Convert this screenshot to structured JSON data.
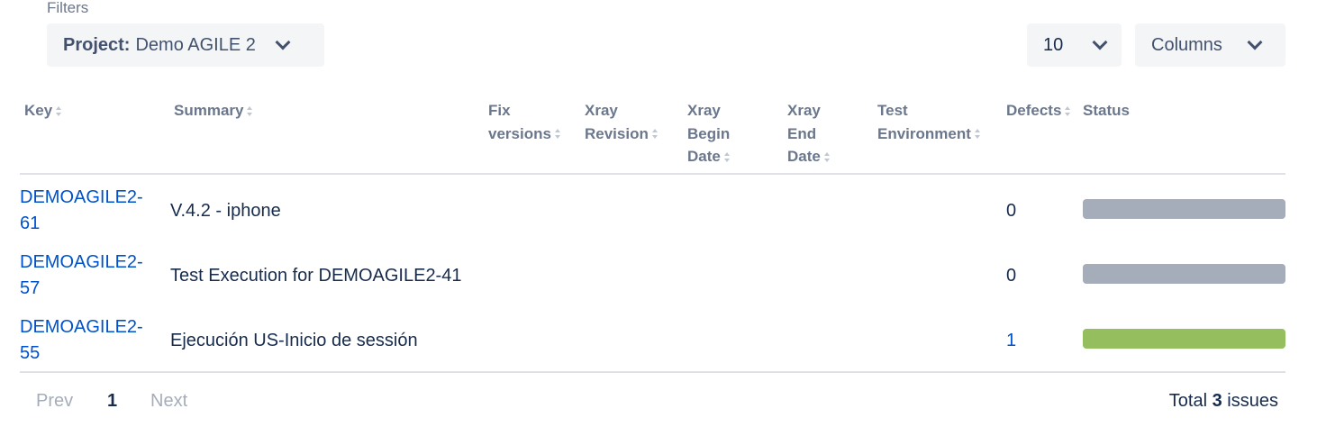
{
  "filters": {
    "label": "Filters",
    "project_key": "Project:",
    "project_value": "Demo AGILE 2"
  },
  "page_size": {
    "value": "10"
  },
  "columns_button": {
    "label": "Columns"
  },
  "headers": {
    "key": "Key",
    "summary": "Summary",
    "fix_versions": [
      "Fix",
      "versions"
    ],
    "xray_revision": [
      "Xray",
      "Revision"
    ],
    "xray_begin_date": [
      "Xray",
      "Begin",
      "Date"
    ],
    "xray_end_date": [
      "Xray",
      "End",
      "Date"
    ],
    "test_environment": [
      "Test",
      "Environment"
    ],
    "defects": "Defects",
    "status": "Status"
  },
  "rows": [
    {
      "key": [
        "DEMOAGILE2-",
        "61"
      ],
      "summary": "V.4.2 - iphone",
      "defects": "0",
      "defects_link": false,
      "status_color": "#a5adba",
      "status_fraction": 1
    },
    {
      "key": [
        "DEMOAGILE2-",
        "57"
      ],
      "summary": "Test Execution for DEMOAGILE2-41",
      "defects": "0",
      "defects_link": false,
      "status_color": "#a5adba",
      "status_fraction": 1
    },
    {
      "key": [
        "DEMOAGILE2-",
        "55"
      ],
      "summary": "Ejecución US-Inicio de sessión",
      "defects": "1",
      "defects_link": true,
      "status_color": "#95bf5f",
      "status_fraction": 1
    }
  ],
  "pagination": {
    "prev": "Prev",
    "current": "1",
    "next": "Next",
    "total_prefix": "Total",
    "total_count": "3",
    "total_suffix": "issues"
  },
  "icons": {
    "filter_dropdown": "chevron-down-icon",
    "sort": "sort-icon"
  },
  "colors": {
    "link": "#0052cc",
    "header_text": "#6b778c",
    "status_todo": "#a5adba",
    "status_done": "#95bf5f"
  }
}
